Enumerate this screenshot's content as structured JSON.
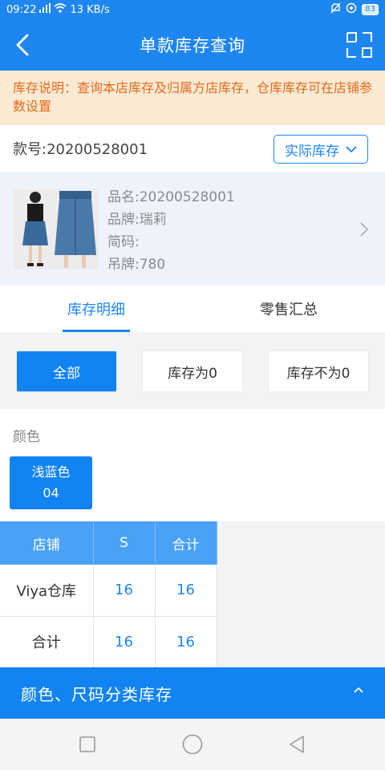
{
  "status_bar": {
    "time": "09:22",
    "net_speed": "13 KB/s",
    "battery": "83"
  },
  "header": {
    "title": "单款库存查询"
  },
  "notice": {
    "text": "库存说明：查询本店库存及归属方店库存，仓库库存可在店铺参数设置"
  },
  "style_number": {
    "label": "款号:20200528001",
    "stock_type": "实际库存"
  },
  "product": {
    "name": "品名:20200528001",
    "brand": "品牌:瑞莉",
    "short_code": "简码:",
    "tag_price": "吊牌:780"
  },
  "tabs": [
    {
      "label": "库存明细",
      "active": true
    },
    {
      "label": "零售汇总",
      "active": false
    }
  ],
  "filters": [
    {
      "label": "全部",
      "active": true
    },
    {
      "label": "库存为0",
      "active": false
    },
    {
      "label": "库存不为0",
      "active": false
    }
  ],
  "color_section": {
    "label": "颜色",
    "selected_color_name": "浅蓝色",
    "selected_color_code": "04"
  },
  "table": {
    "headers": [
      "店铺",
      "S",
      "合计"
    ],
    "rows": [
      [
        "Viya仓库",
        "16",
        "16"
      ],
      [
        "合计",
        "16",
        "16"
      ]
    ]
  },
  "bottom_bar": {
    "label": "颜色、尺码分类库存"
  },
  "colors": {
    "primary": "#1e86f0",
    "notice_text": "#e86a1c",
    "notice_bg": "#fbead3"
  }
}
